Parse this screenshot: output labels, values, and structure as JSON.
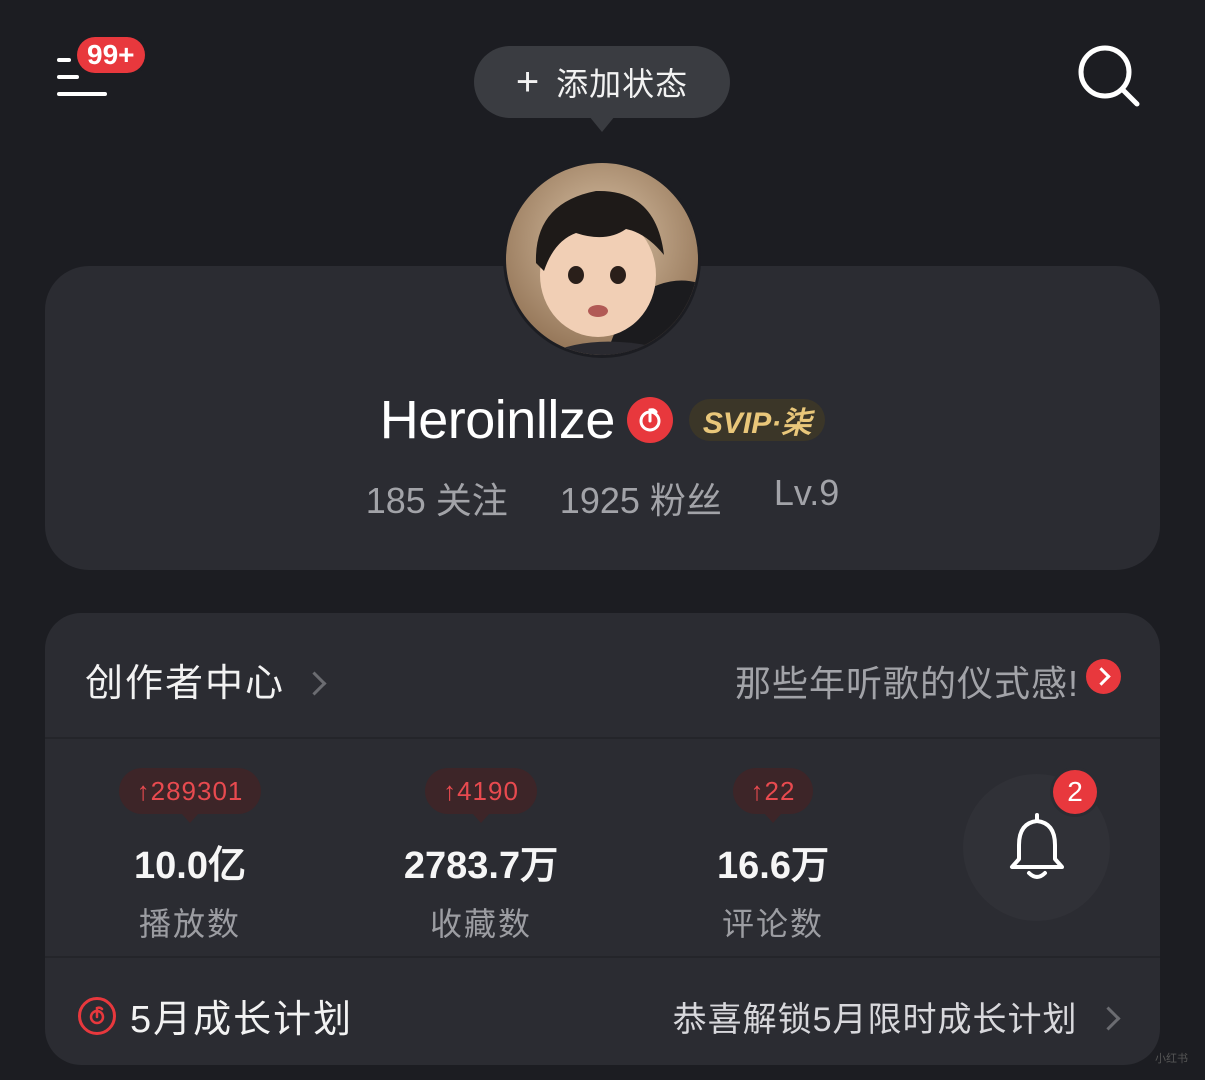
{
  "header": {
    "notification_badge": "99+",
    "status_button_plus": "+",
    "status_button_label": "添加状态"
  },
  "profile": {
    "username": "Heroinllze",
    "vip_badge": "SVIP·柒",
    "following": "185 关注",
    "followers": "1925 粉丝",
    "level": "Lv.9"
  },
  "creator": {
    "title": "创作者中心",
    "promo": "那些年听歌的仪式感!",
    "metrics": [
      {
        "delta": "↑289301",
        "value": "10.0亿",
        "label": "播放数"
      },
      {
        "delta": "↑4190",
        "value": "2783.7万",
        "label": "收藏数"
      },
      {
        "delta": "↑22",
        "value": "16.6万",
        "label": "评论数"
      }
    ],
    "bell_badge": "2",
    "growth_title": "5月成长计划",
    "growth_promo": "恭喜解锁5月限时成长计划"
  },
  "watermark": "小红书",
  "colors": {
    "background": "#1c1d22",
    "card": "#2b2c32",
    "accent_red": "#e8383d",
    "vip_gold": "#e9c77a"
  },
  "icons": [
    "menu-icon",
    "search-icon",
    "bell-icon",
    "netease-music-icon",
    "chevron-right-icon"
  ]
}
